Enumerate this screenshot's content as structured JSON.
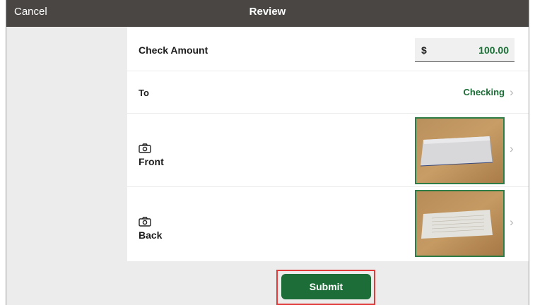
{
  "nav": {
    "cancel_label": "Cancel",
    "title": "Review"
  },
  "check_amount": {
    "label": "Check Amount",
    "currency_symbol": "$",
    "value": "100.00"
  },
  "to_account": {
    "label": "To",
    "value": "Checking"
  },
  "front": {
    "label": "Front",
    "icon": "camera-icon"
  },
  "back": {
    "label": "Back",
    "icon": "camera-icon"
  },
  "footer": {
    "submit_label": "Submit"
  },
  "colors": {
    "nav_bar": "#4a4644",
    "accent_green": "#1c6d37",
    "value_green": "#1a6e35",
    "highlight_red": "#e23b3b",
    "side_panel": "#ececec"
  }
}
